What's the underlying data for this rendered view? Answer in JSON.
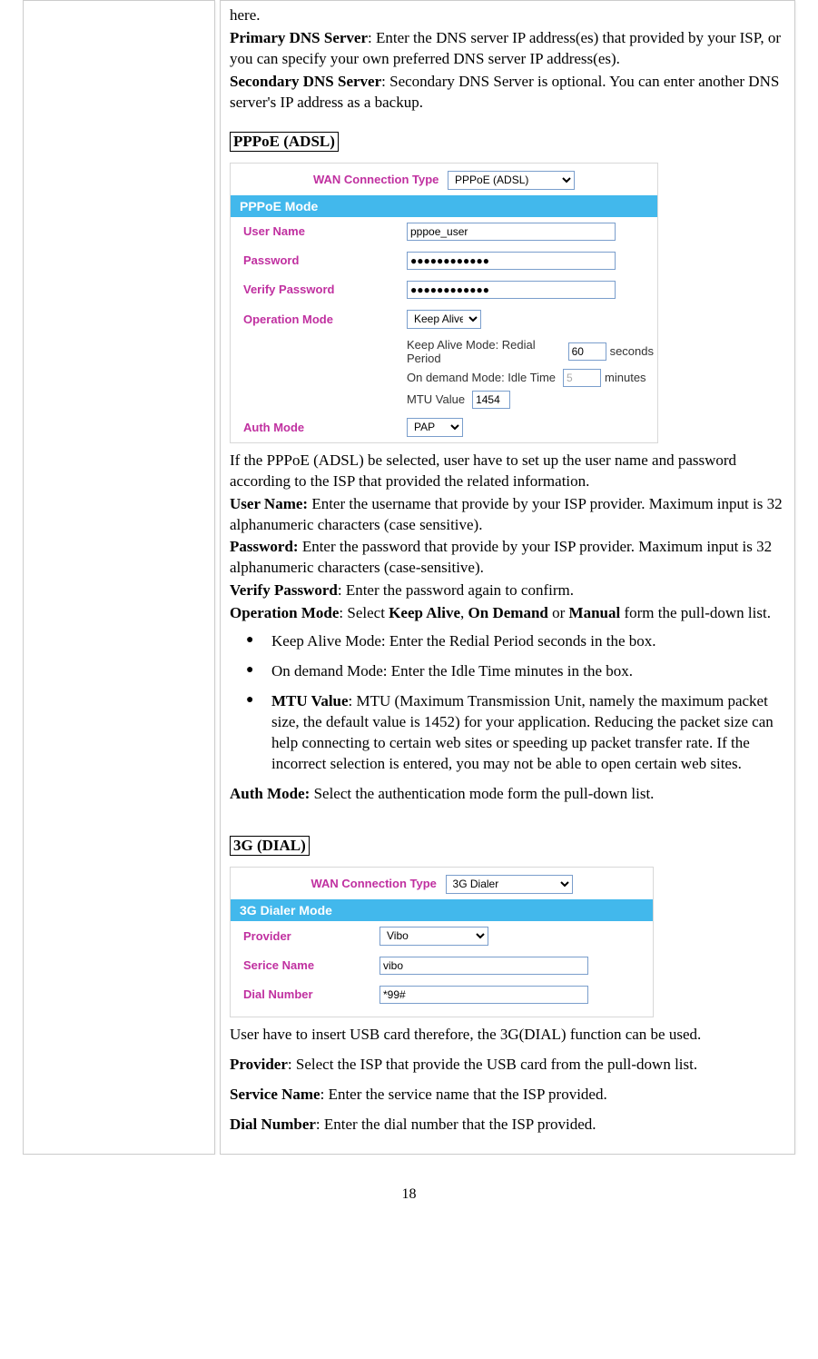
{
  "intro": {
    "here": "here.",
    "pdns_b": "Primary DNS Server",
    "pdns_t": ": Enter the DNS server IP address(es) that provided by your ISP, or you can specify your own preferred DNS server IP address(es).",
    "sdns_b": "Secondary DNS Server",
    "sdns_t": ": Secondary DNS Server is optional. You can enter another DNS server's IP address as a backup."
  },
  "pppoe": {
    "tag": "PPPoE (ADSL)",
    "fig": {
      "wan_label": "WAN Connection Type",
      "wan_value": "PPPoE (ADSL)",
      "band": "PPPoE Mode",
      "user_lbl": "User Name",
      "user_val": "pppoe_user",
      "pass_lbl": "Password",
      "pass_val": "●●●●●●●●●●●●",
      "vpass_lbl": "Verify Password",
      "vpass_val": "●●●●●●●●●●●●",
      "op_lbl": "Operation Mode",
      "op_val": "Keep Alive",
      "s1a": "Keep Alive Mode: Redial Period",
      "s1v": "60",
      "s1b": "seconds",
      "s2a": "On demand Mode: Idle Time",
      "s2v": "5",
      "s2b": "minutes",
      "s3a": "MTU Value",
      "s3v": "1454",
      "auth_lbl": "Auth Mode",
      "auth_val": "PAP"
    },
    "p1": "If the PPPoE (ADSL) be selected, user have to set up the user name and password according to the ISP that provided the related information.",
    "un_b": "User Name:",
    "un_t": " Enter the username that provide by your ISP provider. Maximum input is 32 alphanumeric characters (case sensitive).",
    "pw_b": "Password:",
    "pw_t": " Enter the password that provide by your ISP provider. Maximum input is 32 alphanumeric characters (case-sensitive).",
    "vp_b": "Verify Password",
    "vp_t": ": Enter the password again to confirm.",
    "om_b": "Operation Mode",
    "om_m": ": Select ",
    "om_k": "Keep Alive",
    "om_c": ", ",
    "om_o": "On Demand",
    "om_or": " or ",
    "om_man": "Manual",
    "om_e": " form the pull-down list.",
    "b1": "Keep Alive Mode: Enter the Redial Period  seconds in the box.",
    "b2": "On demand Mode: Enter the Idle Time minutes in the box.",
    "b3_b": "MTU Value",
    "b3_t": ":  MTU (Maximum Transmission Unit, namely the maximum packet size, the default value is 1452) for your application. Reducing the packet size can help connecting to certain web sites or speeding up packet transfer rate. If the incorrect selection is entered, you may not be able to open certain web sites.",
    "auth_b": "Auth Mode:",
    "auth_t": " Select the authentication mode form the pull-down list."
  },
  "g3": {
    "tag": "3G (DIAL)",
    "fig": {
      "wan_label": "WAN Connection Type",
      "wan_value": "3G Dialer",
      "band": "3G Dialer Mode",
      "prov_lbl": "Provider",
      "prov_val": "Vibo",
      "srv_lbl": "Serice Name",
      "srv_val": "vibo",
      "dial_lbl": "Dial Number",
      "dial_val": "*99#"
    },
    "p1": "User have to insert USB card therefore, the 3G(DIAL) function can be used.",
    "prov_b": "Provider",
    "prov_t": ": Select the ISP that provide the USB card from the pull-down list.",
    "srv_b": "Service Name",
    "srv_t": ": Enter the service name that the ISP provided.",
    "dial_b": "Dial Number",
    "dial_t": ": Enter the dial number that the ISP provided."
  },
  "page_num": "18"
}
